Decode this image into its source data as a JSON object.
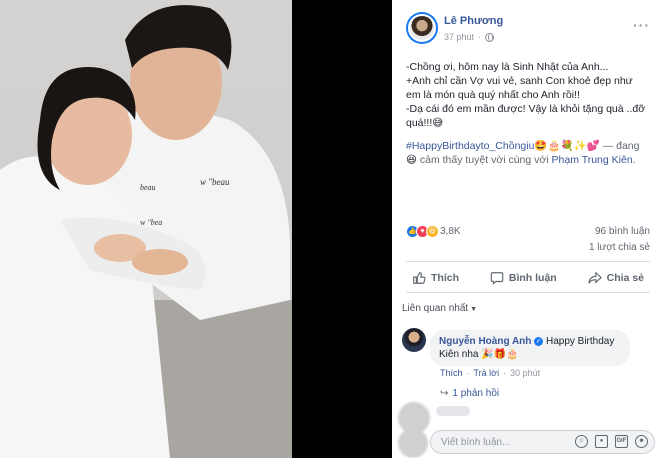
{
  "post": {
    "author": "Lê Phương",
    "time": "37 phút",
    "text_lines": "-Chồng ơi, hôm nay là Sinh Nhật của Anh...\n+Anh chỉ cần Vợ vui vẻ, sanh Con khoẻ đẹp như em là món quà quý nhất cho Anh rồi!!\n-Dạ cái đó em mần được! Vậy là khỏi tặng quà ..đỡ quá!!!😅",
    "hashtag": "#HappyBirthdayto_Chồngiu",
    "hashtag_emojis": "🤩🎂💐✨💕",
    "feeling_prefix": " — đang",
    "feeling_emoji": "😆",
    "feeling_text": " cảm thấy tuyệt vời cùng với ",
    "tagged": "Phạm Trung Kiên",
    "feeling_end": "."
  },
  "stats": {
    "reactions": "3,8K",
    "comments": "96 bình luận",
    "shares": "1 lượt chia sẻ"
  },
  "actions": {
    "like": "Thích",
    "comment": "Bình luận",
    "share": "Chia sẻ"
  },
  "comments_section": {
    "sort_label": "Liên quan nhất",
    "comment": {
      "author": "Nguyễn Hoàng Anh",
      "text": "Happy Birthday Kiên nha 🎉🎁🎂",
      "like": "Thích",
      "reply": "Trả lời",
      "time": "30 phút",
      "replies": "1 phản hồi"
    },
    "input_placeholder": "Viết bình luận..."
  },
  "icons": [
    "globe-icon",
    "more-icon",
    "like-icon",
    "comment-icon",
    "share-icon",
    "emoji-icon",
    "camera-icon",
    "gif-icon",
    "sticker-icon"
  ],
  "colors": {
    "link": "#385898",
    "accent": "#1877f2"
  }
}
